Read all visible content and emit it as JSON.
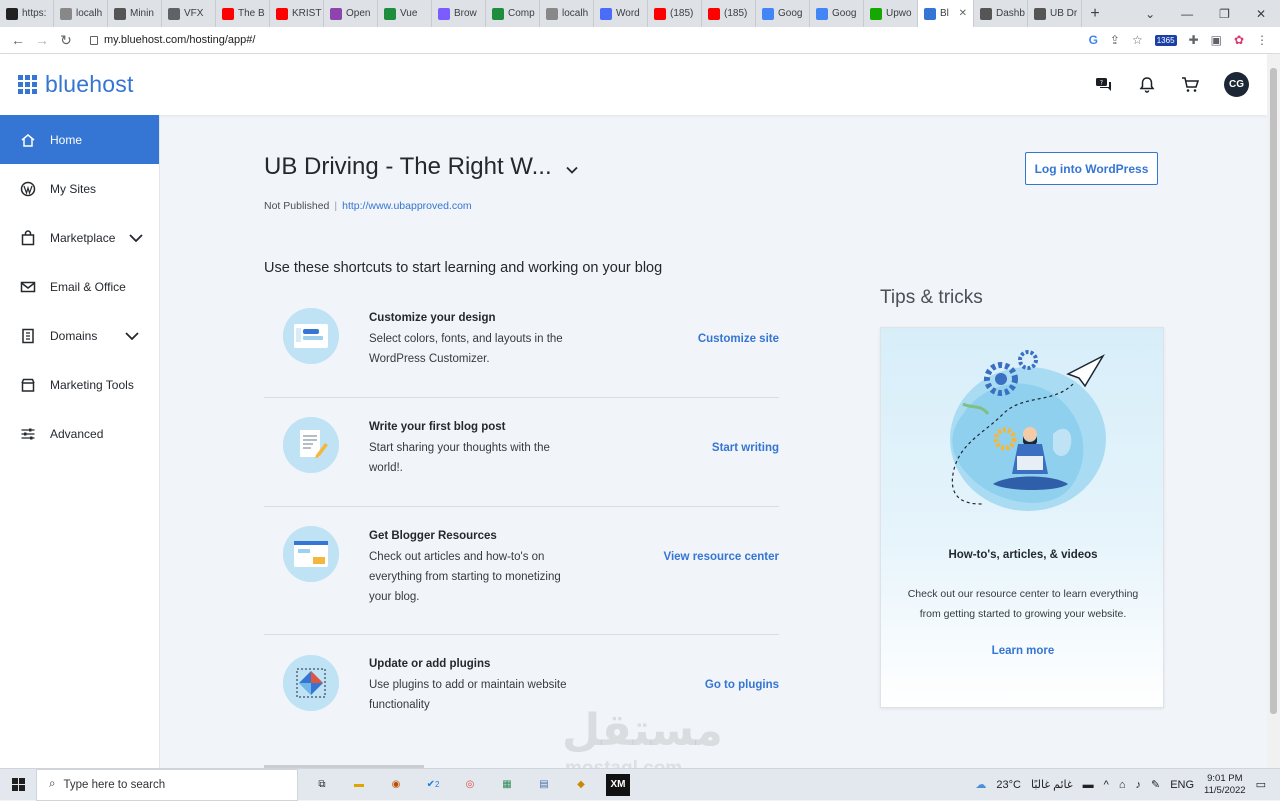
{
  "browser": {
    "tabs": [
      {
        "label": "https:",
        "color": "#222222"
      },
      {
        "label": "localh",
        "color": "#888888"
      },
      {
        "label": "Minin",
        "color": "#555555"
      },
      {
        "label": "VFX",
        "color": "#5f6368"
      },
      {
        "label": "The B",
        "color": "#ff0000"
      },
      {
        "label": "KRIST",
        "color": "#ff0000"
      },
      {
        "label": "Open",
        "color": "#8e44ad"
      },
      {
        "label": "Vue",
        "color": "#1e8e3e"
      },
      {
        "label": "Brow",
        "color": "#7b5cff"
      },
      {
        "label": "Comp",
        "color": "#1e8e3e"
      },
      {
        "label": "localh",
        "color": "#888888"
      },
      {
        "label": "Word",
        "color": "#4a6cf7"
      },
      {
        "label": "(185)",
        "color": "#ff0000"
      },
      {
        "label": "(185)",
        "color": "#ff0000"
      },
      {
        "label": "Goog",
        "color": "#4285f4"
      },
      {
        "label": "Goog",
        "color": "#4285f4"
      },
      {
        "label": "Upwo",
        "color": "#14a800"
      },
      {
        "label": "Bl",
        "color": "#3575d3"
      },
      {
        "label": "Dashb",
        "color": "#555555"
      },
      {
        "label": "UB Dr",
        "color": "#555555"
      }
    ],
    "active_tab_index": 17,
    "url": "my.bluehost.com/hosting/app#/",
    "ext_badge": "1365"
  },
  "header": {
    "logo_text": "bluehost",
    "avatar_initials": "CG"
  },
  "sidebar": {
    "items": [
      {
        "label": "Home",
        "icon": "home-icon",
        "active": true,
        "expandable": false
      },
      {
        "label": "My Sites",
        "icon": "wordpress-icon",
        "active": false,
        "expandable": false
      },
      {
        "label": "Marketplace",
        "icon": "bag-icon",
        "active": false,
        "expandable": true
      },
      {
        "label": "Email & Office",
        "icon": "mail-icon",
        "active": false,
        "expandable": false
      },
      {
        "label": "Domains",
        "icon": "domain-icon",
        "active": false,
        "expandable": true
      },
      {
        "label": "Marketing Tools",
        "icon": "store-icon",
        "active": false,
        "expandable": false
      },
      {
        "label": "Advanced",
        "icon": "sliders-icon",
        "active": false,
        "expandable": false
      }
    ]
  },
  "site": {
    "title": "UB Driving - The Right W...",
    "status": "Not Published",
    "url": "http://www.ubapproved.com",
    "login_button": "Log into WordPress"
  },
  "shortcuts": {
    "heading": "Use these shortcuts to start learning and working on your blog",
    "items": [
      {
        "title": "Customize your design",
        "desc": "Select colors, fonts, and layouts in the WordPress Customizer.",
        "link": "Customize site",
        "icon": "customize-icon"
      },
      {
        "title": "Write your first blog post",
        "desc": "Start sharing your thoughts with the world!.",
        "link": "Start writing",
        "icon": "blog-post-icon"
      },
      {
        "title": "Get Blogger Resources",
        "desc": "Check out articles and how-to's on everything from starting to monetizing your blog.",
        "link": "View resource center",
        "icon": "resources-icon"
      },
      {
        "title": "Update or add plugins",
        "desc": "Use plugins to add or maintain website functionality",
        "link": "Go to plugins",
        "icon": "plugins-icon"
      }
    ]
  },
  "tips": {
    "heading": "Tips & tricks",
    "card_title": "How-to's, articles, & videos",
    "card_body": "Check out our resource center to learn everything from getting started to growing your website.",
    "card_link": "Learn more"
  },
  "watermark": {
    "text": "مستقل",
    "sub": "mostaql.com"
  },
  "taskbar": {
    "search_placeholder": "Type here to search",
    "weather": "23°C",
    "weather_desc": "غائم غالبًا",
    "language": "ENG",
    "time": "9:01 PM",
    "date": "11/5/2022",
    "edge_badge": "2"
  }
}
